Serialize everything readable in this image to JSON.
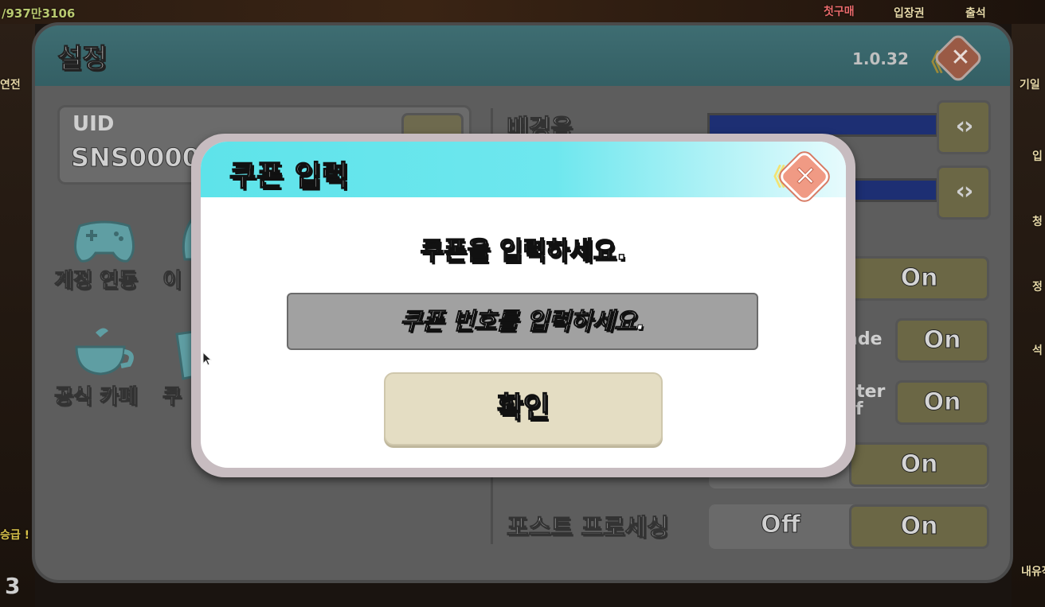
{
  "background": {
    "top_left_text": "/937만3106",
    "top_items": [
      "첫구매",
      "입장권",
      "출석"
    ],
    "left_side_text": [
      "연전",
      "승급 !"
    ],
    "right_side_text": [
      "기일",
      "입",
      "청",
      "정",
      "석",
      "내유작"
    ],
    "bottom_left_number": "3"
  },
  "settings": {
    "title": "설정",
    "version": "1.0.32",
    "uid_label": "UID",
    "uid_value": "SNS0000",
    "icons": [
      {
        "label": "계정 연동",
        "icon": "gamepad-icon"
      },
      {
        "label": "이",
        "icon": "person-icon"
      },
      {
        "label": "공식 카페",
        "icon": "coffee-cup-icon"
      },
      {
        "label": "쿠",
        "icon": "coupon-icon"
      }
    ],
    "rows": {
      "bgm_label": "배경음",
      "fade_label": "ade",
      "ster_label": "ster",
      "ster_label2": "f",
      "post_processing_label": "포스트 프로세싱",
      "on": "On",
      "off": "Off"
    }
  },
  "dialog": {
    "title": "쿠폰 입력",
    "message": "쿠폰을 입력하세요.",
    "input_placeholder": "쿠폰 번호를 입력하세요.",
    "input_value": "",
    "confirm_label": "확인",
    "close_symbol": "✕",
    "arrow_symbol": "《"
  },
  "colors": {
    "dialog_header": "#6ee7ee",
    "confirm_button": "#e4ddc3",
    "close_button": "#f09a84",
    "slider_fill": "#1d2f73"
  }
}
